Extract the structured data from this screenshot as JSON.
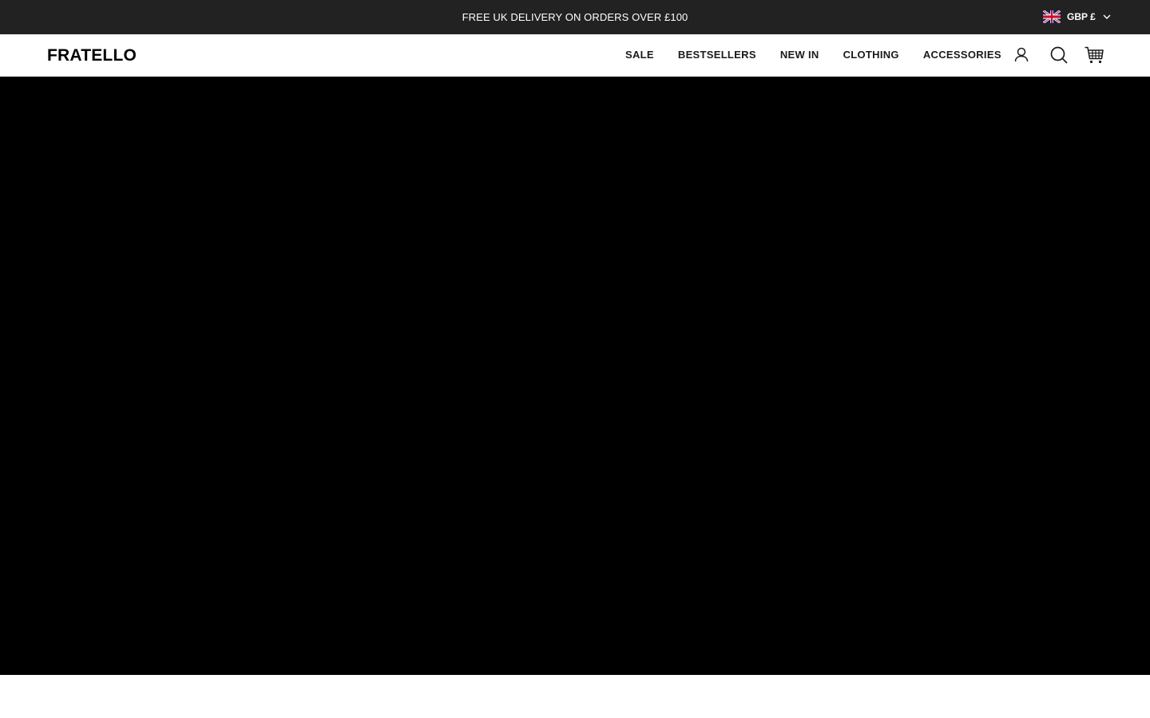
{
  "announcement": {
    "text": "FREE UK DELIVERY ON ORDERS OVER £100"
  },
  "currency": {
    "label": "GBP £",
    "flag_icon": "uk-flag-icon",
    "chevron_icon": "chevron-down-icon"
  },
  "header": {
    "logo": "FRATELLO",
    "nav": [
      {
        "label": "SALE"
      },
      {
        "label": "BESTSELLERS"
      },
      {
        "label": "NEW IN"
      },
      {
        "label": "CLOTHING"
      },
      {
        "label": "ACCESSORIES"
      }
    ],
    "icons": {
      "account": "account-icon",
      "search": "search-icon",
      "cart": "cart-icon"
    }
  },
  "colors": {
    "announcement_bg": "#222222",
    "header_bg": "#ffffff",
    "hero_bg": "#000000",
    "text_dark": "#1a1a1a"
  }
}
